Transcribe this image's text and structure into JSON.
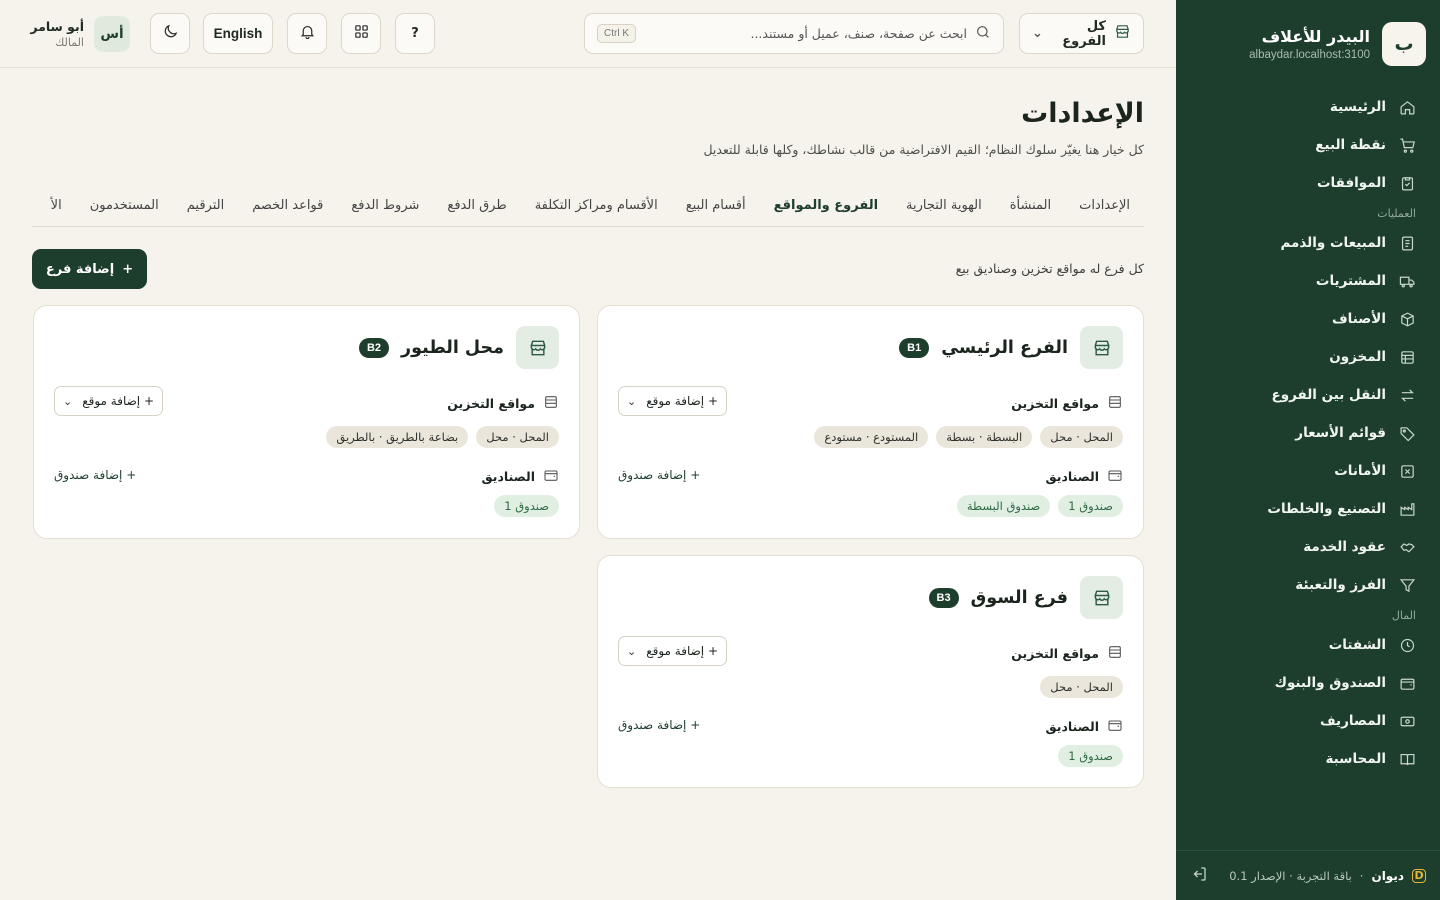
{
  "sidebar": {
    "brand_letter": "ب",
    "brand_name": "البيدر للأعلاف",
    "brand_host": "albaydar.localhost:3100",
    "items": [
      {
        "label": "الرئيسية",
        "icon": "home-icon"
      },
      {
        "label": "نقطة البيع",
        "icon": "cart-icon"
      },
      {
        "label": "الموافقات",
        "icon": "clipboard-check-icon"
      }
    ],
    "section_operations": "العمليات",
    "operations": [
      {
        "label": "المبيعات والذمم",
        "icon": "receipt-icon"
      },
      {
        "label": "المشتريات",
        "icon": "truck-icon"
      },
      {
        "label": "الأصناف",
        "icon": "box-icon"
      },
      {
        "label": "المخزون",
        "icon": "warehouse-icon"
      },
      {
        "label": "النقل بين الفروع",
        "icon": "transfer-icon"
      },
      {
        "label": "قوائم الأسعار",
        "icon": "tag-icon"
      },
      {
        "label": "الأمانات",
        "icon": "x-box-icon"
      },
      {
        "label": "التصنيع والخلطات",
        "icon": "factory-icon"
      },
      {
        "label": "عقود الخدمة",
        "icon": "handshake-icon"
      },
      {
        "label": "الفرز والتعبئة",
        "icon": "filter-icon"
      }
    ],
    "section_finance": "المال",
    "finance": [
      {
        "label": "الشفتات",
        "icon": "clock-icon"
      },
      {
        "label": "الصندوق والبنوك",
        "icon": "wallet-icon"
      },
      {
        "label": "المصاريف",
        "icon": "banknote-icon"
      },
      {
        "label": "المحاسبة",
        "icon": "book-icon"
      }
    ],
    "footer": {
      "product": "ديوان",
      "dot": "·",
      "plan": "باقة التجربة · الإصدار 0.1"
    }
  },
  "topbar": {
    "branch_select": "كل الفروع",
    "search_placeholder": "ابحث عن صفحة، صنف، عميل أو مستند...",
    "search_shortcut": "Ctrl K",
    "help_label": "?",
    "lang_label": "English",
    "user_initials": "أس",
    "user_name": "أبو سامر",
    "user_role": "المالك"
  },
  "page": {
    "title": "الإعدادات",
    "subtitle": "كل خيار هنا يغيّر سلوك النظام؛ القيم الافتراضية من قالب نشاطك، وكلها قابلة للتعديل",
    "tabs": [
      "الإعدادات",
      "المنشأة",
      "الهوية التجارية",
      "الفروع والمواقع",
      "أقسام البيع",
      "الأقسام ومراكز التكلفة",
      "طرق الدفع",
      "شروط الدفع",
      "قواعد الخصم",
      "الترقيم",
      "المستخدمون",
      "الأ"
    ],
    "active_tab": "الفروع والمواقع",
    "section_note": "كل فرع له مواقع تخزين وصناديق بيع",
    "add_branch": "إضافة فرع"
  },
  "labels": {
    "storage": "مواقع التخزين",
    "add_location": "+ إضافة موقع",
    "boxes": "الصناديق",
    "add_box": "+ إضافة صندوق"
  },
  "branches": [
    {
      "name": "الفرع الرئيسي",
      "code": "B1",
      "locations": [
        "المحل · محل",
        "البسطة · بسطة",
        "المستودع · مستودع"
      ],
      "boxes": [
        "صندوق 1",
        "صندوق البسطة"
      ]
    },
    {
      "name": "محل الطيور",
      "code": "B2",
      "locations": [
        "المحل · محل",
        "بضاعة بالطريق · بالطريق"
      ],
      "boxes": [
        "صندوق 1"
      ]
    },
    {
      "name": "فرع السوق",
      "code": "B3",
      "locations": [
        "المحل · محل"
      ],
      "boxes": [
        "صندوق 1"
      ]
    }
  ],
  "colors": {
    "sidebar_bg": "#1d3d2d",
    "page_bg": "#f6f3ec",
    "accent": "#1d3d2d",
    "box_chip": "#e1efe2"
  }
}
